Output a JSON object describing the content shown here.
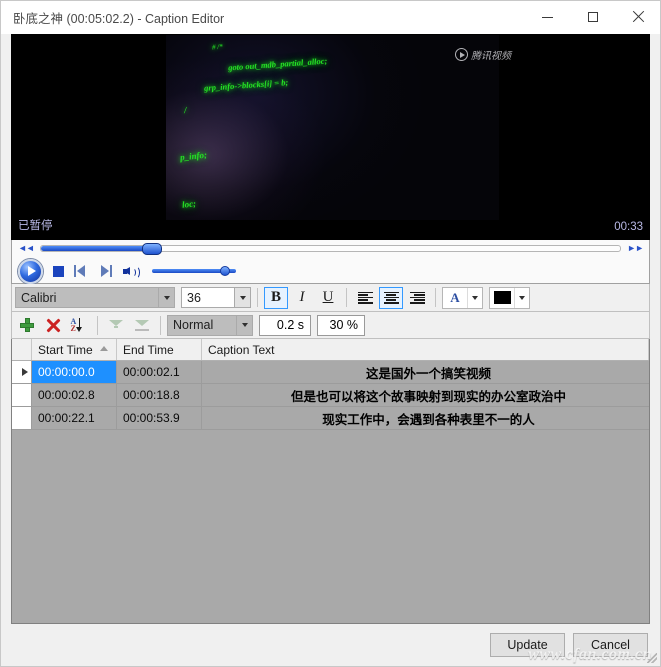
{
  "window": {
    "title": "卧底之神 (00:05:02.2) - Caption Editor",
    "minimize_label": "Minimize",
    "maximize_label": "Maximize",
    "close_label": "Close"
  },
  "video": {
    "status": "已暂停",
    "time": "00:33",
    "watermark_brand": "腾讯视频",
    "code_lines": [
      "# /*",
      "goto out_mdb_partial_alloc;",
      "grp_info->blocks[i] = b;",
      "/",
      "p_info;",
      "loc;"
    ]
  },
  "transport": {
    "rewind_label": "◄◄",
    "forward_label": "►►",
    "play_label": "Play",
    "stop_label": "Stop",
    "prev_frame_label": "Previous frame",
    "next_frame_label": "Next frame",
    "volume_label": "Volume",
    "seek_position_pct": 19,
    "volume_pct": 80
  },
  "format_toolbar": {
    "font_family": "Calibri",
    "font_size": "36",
    "bold_label": "B",
    "italic_label": "I",
    "underline_label": "U",
    "align_left_label": "Align left",
    "align_center_label": "Align center",
    "align_right_label": "Align right",
    "font_color_label": "A",
    "fill_color_value": "#000000",
    "bold_active": true,
    "align_center_active": true
  },
  "caption_toolbar": {
    "add_label": "Add",
    "delete_label": "Delete",
    "sort_label": "Sort",
    "filter_up_label": "Filter up",
    "filter_down_label": "Filter down",
    "style": "Normal",
    "fade_duration": "0.2 s",
    "opacity": "30 %"
  },
  "grid": {
    "columns": [
      "",
      "Start Time",
      "End Time",
      "Caption Text"
    ],
    "sorted_column": "Start Time",
    "rows": [
      {
        "selected": true,
        "start": "00:00:00.0",
        "end": "00:00:02.1",
        "text": "这是国外一个搞笑视频"
      },
      {
        "selected": false,
        "start": "00:00:02.8",
        "end": "00:00:18.8",
        "text": "但是也可以将这个故事映射到现实的办公室政治中"
      },
      {
        "selected": false,
        "start": "00:00:22.1",
        "end": "00:00:53.9",
        "text": "现实工作中，会遇到各种表里不一的人"
      }
    ]
  },
  "footer": {
    "update_label": "Update",
    "cancel_label": "Cancel",
    "watermark": "www.cfan.com.cn"
  }
}
